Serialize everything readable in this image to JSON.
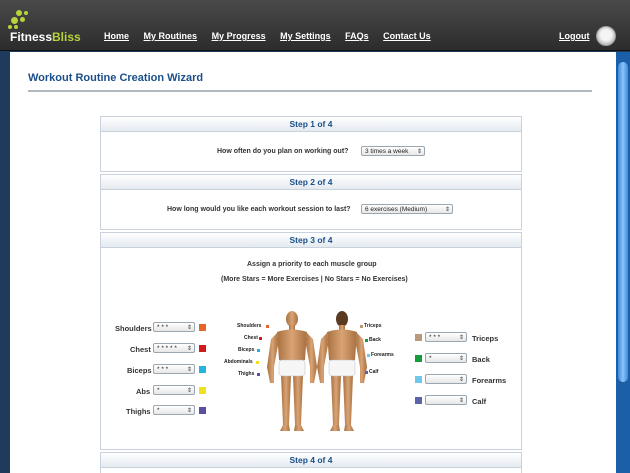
{
  "brand": {
    "name": "FitnessBliss",
    "prefix": "Fitness",
    "suffix": "Bliss",
    "accent": "#b6d33c"
  },
  "nav": [
    "Home",
    "My Routines",
    "My Progress",
    "My Settings",
    "FAQs",
    "Contact Us"
  ],
  "logout": "Logout",
  "page_title": "Workout Routine Creation Wizard",
  "step1": {
    "header": "Step 1 of 4",
    "question": "How often do you plan on working out?",
    "value": "3 times a week"
  },
  "step2": {
    "header": "Step 2 of 4",
    "question": "How long would you like each workout session to last?",
    "value": "6 exercises (Medium)"
  },
  "step3": {
    "header": "Step 3 of 4",
    "instruction": "Assign a priority to each muscle group",
    "legend": "(More Stars = More Exercises | No Stars = No Exercises)",
    "left_groups": [
      {
        "label": "Shoulders",
        "value": "* * *",
        "color": "#e8652a"
      },
      {
        "label": "Chest",
        "value": "* * * * *",
        "color": "#d11a1a"
      },
      {
        "label": "Biceps",
        "value": "* * *",
        "color": "#27b3df"
      },
      {
        "label": "Abs",
        "value": "*",
        "color": "#f0e11d"
      },
      {
        "label": "Thighs",
        "value": "*",
        "color": "#5a4fa0"
      }
    ],
    "right_groups": [
      {
        "label": "Triceps",
        "value": "* * *",
        "color": "#b99a7b"
      },
      {
        "label": "Back",
        "value": "*",
        "color": "#169c3c"
      },
      {
        "label": "Forearms",
        "value": "",
        "color": "#6ec9ea"
      },
      {
        "label": "Calf",
        "value": "",
        "color": "#5b64a8"
      }
    ],
    "front_tags": [
      "Shoulders",
      "Chest",
      "Biceps",
      "Abdominals",
      "Thighs"
    ],
    "back_tags": [
      "Triceps",
      "Back",
      "Forearms",
      "Calf"
    ]
  },
  "step4": {
    "header": "Step 4 of 4"
  }
}
